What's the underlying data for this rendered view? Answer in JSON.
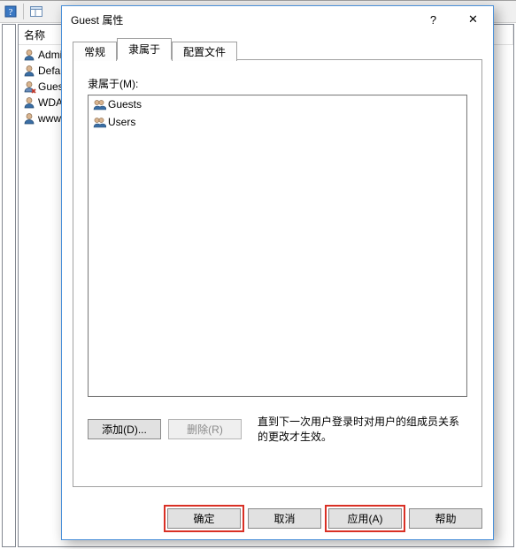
{
  "mmc": {
    "column_name": "名称",
    "users": [
      {
        "name": "Admi"
      },
      {
        "name": "Defa"
      },
      {
        "name": "Gues"
      },
      {
        "name": "WDA"
      },
      {
        "name": "www."
      }
    ]
  },
  "dialog": {
    "title": "Guest 属性",
    "help_glyph": "?",
    "close_glyph": "✕",
    "tabs": {
      "general": "常规",
      "memberof": "隶属于",
      "profile": "配置文件"
    },
    "memberof_label": "隶属于(M):",
    "groups": [
      {
        "name": "Guests"
      },
      {
        "name": "Users"
      }
    ],
    "buttons": {
      "add": "添加(D)...",
      "remove": "删除(R)",
      "ok": "确定",
      "cancel": "取消",
      "apply": "应用(A)",
      "help": "帮助"
    },
    "note": "直到下一次用户登录时对用户的组成员关系的更改才生效。"
  }
}
